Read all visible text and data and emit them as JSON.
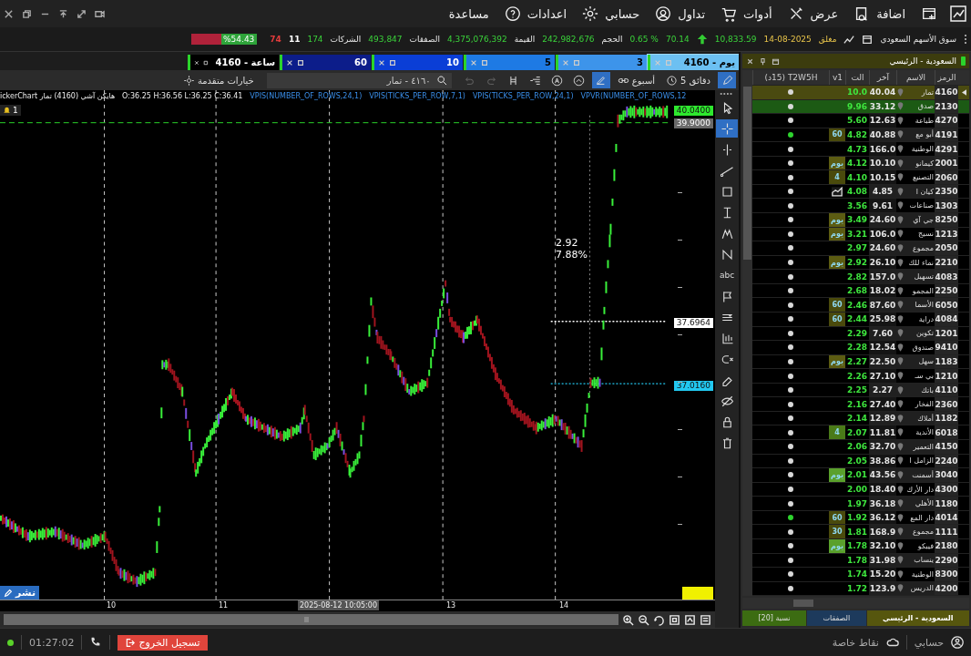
{
  "menu": [
    {
      "label": "اضافة"
    },
    {
      "label": "عرض"
    },
    {
      "label": "أدوات"
    },
    {
      "label": "تداول"
    },
    {
      "label": "حسابي"
    },
    {
      "label": "اعدادات"
    },
    {
      "label": "مساعدة"
    }
  ],
  "market": {
    "name": "سوق الأسهم السعودي",
    "status": "مغلق",
    "date": "14-08-2025",
    "index": "10,833.59",
    "change": "70.14",
    "change_pct": "0.65 %",
    "stats": [
      {
        "label": "الحجم",
        "value": "242,982,676"
      },
      {
        "label": "القيمة",
        "value": "4,375,076,392"
      },
      {
        "label": "الصفقات",
        "value": "493,847"
      },
      {
        "label": "الشركات",
        "value": "174"
      }
    ],
    "breadth": [
      {
        "value": "11",
        "color": "#ffffff"
      },
      {
        "value": "74",
        "color": "#e23c3c"
      }
    ],
    "ratio": {
      "label": "%54.43",
      "level": 0.5443
    }
  },
  "chart_tabs": [
    {
      "label": "4160 - يوم",
      "color": "#6cc0f2",
      "selected": true
    },
    {
      "label": "3",
      "color": "#3d94ea",
      "selected": false
    },
    {
      "label": "5",
      "color": "#1e7ae4",
      "selected": false
    },
    {
      "label": "10",
      "color": "#0a3ed6",
      "selected": false
    },
    {
      "label": "60",
      "color": "#0c1d8a",
      "selected": false
    },
    {
      "label": "4160 - ساعة",
      "color": "#000000",
      "selected": false
    }
  ],
  "toolbar": {
    "interval": "5 دقائق",
    "range": "أسبوع",
    "search": "٤١٦٠ - تمار",
    "advanced": "خيارات متقدمة",
    "icons": [
      {
        "selected": true,
        "disabled": false
      },
      {
        "selected": true,
        "disabled": false
      },
      {
        "selected": false,
        "disabled": false
      },
      {
        "selected": false,
        "disabled": false
      },
      {
        "selected": false,
        "disabled": false
      },
      {
        "selected": false,
        "disabled": false
      },
      {
        "selected": false,
        "disabled": true
      },
      {
        "selected": false,
        "disabled": true
      }
    ]
  },
  "chart": {
    "legend_title": "ickerChart هايكن آشي (4160) تمار",
    "ohlc": "O:36.25 H:36.56 L:36.25 C:36.41",
    "indicators": [
      "VPVR(NUMBER_OF_ROWS,12",
      "VPIS(TICKS_PER_ROW,24,1)",
      "VPIS(TICKS_PER_ROW,7,1)",
      "VPIS(NUMBER_OF_ROWS,24,1)"
    ],
    "alerts": "1",
    "price_tags": [
      {
        "value": "40.0400",
        "color": "#2ee82e"
      },
      {
        "value": "39.9000",
        "color": "#6a6a6a"
      },
      {
        "value": "37.6964",
        "color": "#ffffff"
      },
      {
        "value": "37.0160",
        "color": "#22c8f0"
      }
    ],
    "measure": [
      "2.92",
      "7.88%"
    ],
    "x_labels": [
      "14",
      "13",
      "2025-08-12 10:05:00",
      "11",
      "10"
    ],
    "publish": "نشر"
  },
  "tools": [
    {
      "selected": false
    },
    {
      "selected": true
    },
    {
      "selected": false
    },
    {
      "selected": false
    },
    {
      "selected": false
    },
    {
      "selected": false
    },
    {
      "selected": false
    },
    {
      "selected": false
    },
    {
      "selected": false,
      "label": "abc"
    },
    {
      "selected": false
    },
    {
      "selected": false
    },
    {
      "selected": false
    },
    {
      "selected": false
    },
    {
      "selected": false
    },
    {
      "selected": false
    },
    {
      "selected": false
    },
    {
      "selected": false
    }
  ],
  "watchlist": {
    "title": "السعودية - الرئيسي",
    "columns": [
      "الرمز",
      "الاسم",
      "آخر",
      "الت",
      "v1",
      "T2W5H (15د)"
    ],
    "rows": [
      {
        "symbol": "4160",
        "name": "تمار",
        "last": "40.04",
        "change": "10.0",
        "active": false,
        "selected": true,
        "highlight": false
      },
      {
        "symbol": "2130",
        "name": "صدق",
        "last": "33.12",
        "change": "9.96",
        "active": false,
        "selected": false,
        "highlight": true
      },
      {
        "symbol": "4270",
        "name": "طباعة",
        "last": "12.63",
        "change": "5.60",
        "active": false,
        "selected": false,
        "highlight": false
      },
      {
        "symbol": "4191",
        "name": "أبو مع",
        "last": "40.88",
        "change": "4.82",
        "signal": {
          "kind": "text",
          "text": "60",
          "color": "#4a4a0c"
        },
        "active": true,
        "selected": false,
        "highlight": false
      },
      {
        "symbol": "4291",
        "name": "الوطنية",
        "last": "166.0",
        "change": "4.73",
        "active": false,
        "selected": false,
        "highlight": false
      },
      {
        "symbol": "2001",
        "name": "كيمانو",
        "last": "10.10",
        "change": "4.12",
        "signal": {
          "kind": "text",
          "text": "يوم",
          "color": "#5c5c12"
        },
        "active": false,
        "selected": false,
        "highlight": false
      },
      {
        "symbol": "2060",
        "name": "التصنيع",
        "last": "10.15",
        "change": "4.10",
        "signal": {
          "kind": "text",
          "text": "4",
          "color": "#4a4a0c"
        },
        "active": false,
        "selected": false,
        "highlight": false
      },
      {
        "symbol": "2350",
        "name": "كيان ا",
        "last": "4.85",
        "change": "4.08",
        "signal": {
          "kind": "chart",
          "color": "#1a1a1a"
        },
        "active": false,
        "selected": false,
        "highlight": false
      },
      {
        "symbol": "1303",
        "name": "صناعات",
        "last": "9.61",
        "change": "3.56",
        "active": false,
        "selected": false,
        "highlight": false
      },
      {
        "symbol": "8250",
        "name": "جي آي",
        "last": "24.60",
        "change": "3.49",
        "signal": {
          "kind": "text",
          "text": "يوم",
          "color": "#5c5c12"
        },
        "active": false,
        "selected": false,
        "highlight": false
      },
      {
        "symbol": "1213",
        "name": "نسيج",
        "last": "106.0",
        "change": "3.21",
        "signal": {
          "kind": "text",
          "text": "يوم",
          "color": "#5c5c12"
        },
        "active": false,
        "selected": false,
        "highlight": false
      },
      {
        "symbol": "2050",
        "name": "مجموع",
        "last": "24.60",
        "change": "2.97",
        "active": false,
        "selected": false,
        "highlight": false
      },
      {
        "symbol": "2210",
        "name": "نماء للك",
        "last": "26.10",
        "change": "2.92",
        "signal": {
          "kind": "text",
          "text": "يوم",
          "color": "#5c5c12"
        },
        "active": false,
        "selected": false,
        "highlight": false
      },
      {
        "symbol": "4083",
        "name": "تسهيل",
        "last": "157.0",
        "change": "2.82",
        "active": false,
        "selected": false,
        "highlight": false
      },
      {
        "symbol": "2250",
        "name": "المجمو",
        "last": "18.02",
        "change": "2.68",
        "active": false,
        "selected": false,
        "highlight": false
      },
      {
        "symbol": "6050",
        "name": "الأسما",
        "last": "87.60",
        "change": "2.46",
        "signal": {
          "kind": "text",
          "text": "60",
          "color": "#4a4a0c"
        },
        "active": false,
        "selected": false,
        "highlight": false
      },
      {
        "symbol": "4084",
        "name": "دراية",
        "last": "25.98",
        "change": "2.44",
        "signal": {
          "kind": "text",
          "text": "60",
          "color": "#4a4a0c"
        },
        "active": false,
        "selected": false,
        "highlight": false
      },
      {
        "symbol": "1201",
        "name": "تكوين",
        "last": "7.60",
        "change": "2.29",
        "active": false,
        "selected": false,
        "highlight": false
      },
      {
        "symbol": "9410",
        "name": "صندوق",
        "last": "12.54",
        "change": "2.28",
        "active": false,
        "selected": false,
        "highlight": false
      },
      {
        "symbol": "1183",
        "name": "سهل",
        "last": "22.50",
        "change": "2.27",
        "signal": {
          "kind": "text",
          "text": "يوم",
          "color": "#5c5c12"
        },
        "active": false,
        "selected": false,
        "highlight": false
      },
      {
        "symbol": "1210",
        "name": "بي سـ",
        "last": "27.10",
        "change": "2.26",
        "active": false,
        "selected": false,
        "highlight": false
      },
      {
        "symbol": "4110",
        "name": "باتك",
        "last": "2.27",
        "change": "2.25",
        "active": false,
        "selected": false,
        "highlight": false
      },
      {
        "symbol": "2360",
        "name": "الفخار",
        "last": "27.40",
        "change": "2.16",
        "active": false,
        "selected": false,
        "highlight": false
      },
      {
        "symbol": "1182",
        "name": "أملاك",
        "last": "12.89",
        "change": "2.14",
        "active": false,
        "selected": false,
        "highlight": false
      },
      {
        "symbol": "6018",
        "name": "الأندية",
        "last": "11.81",
        "change": "2.07",
        "signal": {
          "kind": "text",
          "text": "4",
          "color": "#4a7a18"
        },
        "active": false,
        "selected": false,
        "highlight": false
      },
      {
        "symbol": "4150",
        "name": "التعمير",
        "last": "32.70",
        "change": "2.06",
        "active": false,
        "selected": false,
        "highlight": false
      },
      {
        "symbol": "2240",
        "name": "الزامل ا",
        "last": "38.86",
        "change": "2.05",
        "active": false,
        "selected": false,
        "highlight": false
      },
      {
        "symbol": "3040",
        "name": "أسمنت",
        "last": "43.56",
        "change": "2.01",
        "signal": {
          "kind": "text",
          "text": "يوم",
          "color": "#5aa02c"
        },
        "active": false,
        "selected": false,
        "highlight": false
      },
      {
        "symbol": "4300",
        "name": "دار الأرك",
        "last": "18.40",
        "change": "2.00",
        "active": false,
        "selected": false,
        "highlight": false
      },
      {
        "symbol": "1180",
        "name": "الأهلي",
        "last": "36.18",
        "change": "1.97",
        "active": false,
        "selected": false,
        "highlight": false
      },
      {
        "symbol": "4014",
        "name": "دار المع",
        "last": "36.12",
        "change": "1.92",
        "signal": {
          "kind": "text",
          "text": "60",
          "color": "#4a4a0c"
        },
        "active": true,
        "selected": false,
        "highlight": false
      },
      {
        "symbol": "1111",
        "name": "مجموع",
        "last": "168.9",
        "change": "1.81",
        "signal": {
          "kind": "text",
          "text": "30",
          "color": "#4a4a0c"
        },
        "active": false,
        "selected": false,
        "highlight": false
      },
      {
        "symbol": "2180",
        "name": "فيبكو",
        "last": "32.10",
        "change": "1.78",
        "signal": {
          "kind": "text",
          "text": "يوم",
          "color": "#5aa02c"
        },
        "active": false,
        "selected": false,
        "highlight": false
      },
      {
        "symbol": "2290",
        "name": "ينساب",
        "last": "31.98",
        "change": "1.78",
        "active": false,
        "selected": false,
        "highlight": false
      },
      {
        "symbol": "8300",
        "name": "الوطنية",
        "last": "15.20",
        "change": "1.74",
        "active": false,
        "selected": false,
        "highlight": false
      },
      {
        "symbol": "4200",
        "name": "الدريس",
        "last": "123.9",
        "change": "1.72",
        "active": false,
        "selected": false,
        "highlight": false
      }
    ],
    "footer_tabs": [
      {
        "label": "السعودية - الرئيسي",
        "color": "#56560e",
        "selected": true
      },
      {
        "label": "الصفقات",
        "color": "#1d3a5c",
        "selected": false
      },
      {
        "label": "نسبة [20]",
        "color": "#3c6c12",
        "selected": false
      }
    ]
  },
  "status": {
    "account": "حسابي",
    "points": "نقاط خاصة",
    "time": "01:27:02",
    "logout": "تسجيل الخروج",
    "online": true
  }
}
